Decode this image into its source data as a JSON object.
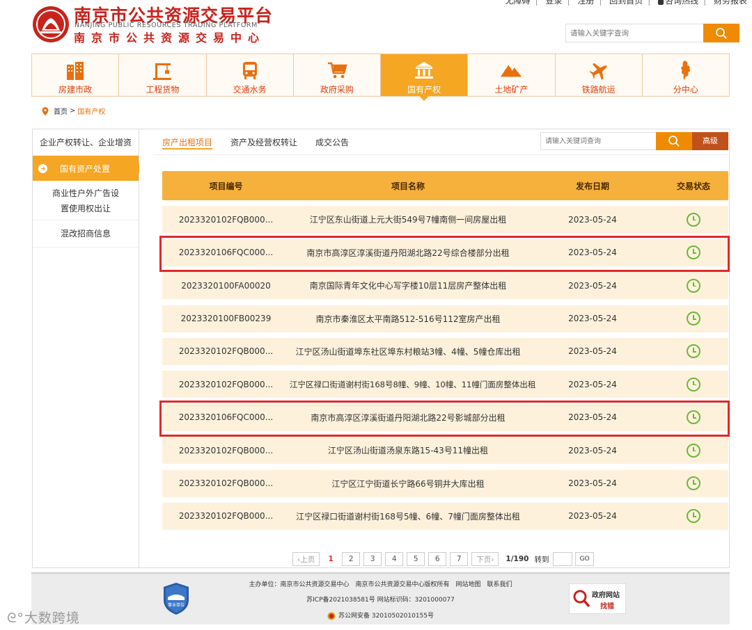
{
  "header": {
    "title": "南京市公共资源交易平台",
    "title_en": "NANJING PUBLIC RESOURCES TRADING PLATFORM",
    "subtitle": "南京市公共资源交易中心",
    "top_links": [
      "无障碍",
      "登录",
      "注册",
      "回到首页",
      "咨询热线",
      "财务报表"
    ],
    "search_placeholder": "请输入关键字查询"
  },
  "nav": {
    "items": [
      {
        "label": "房建市政",
        "icon": "building-icon"
      },
      {
        "label": "工程货物",
        "icon": "crane-icon"
      },
      {
        "label": "交通水务",
        "icon": "bus-icon"
      },
      {
        "label": "政府采购",
        "icon": "cart-icon"
      },
      {
        "label": "国有产权",
        "icon": "bank-icon",
        "active": true
      },
      {
        "label": "土地矿产",
        "icon": "mountain-icon"
      },
      {
        "label": "铁路航运",
        "icon": "plane-icon"
      },
      {
        "label": "分中心",
        "icon": "branch-icon"
      }
    ],
    "active_color": "#f5a623",
    "label_color": "#d9400e"
  },
  "breadcrumb": {
    "home": "首页",
    "sep": ">",
    "current": "国有产权"
  },
  "sidebar": {
    "header": "企业产权转让、企业增资",
    "active": "国有资产处置",
    "items": [
      "商业性户外广告设置使用权出让",
      "混改招商信息"
    ]
  },
  "main": {
    "tabs": [
      "房产出租项目",
      "资产及经营权转让",
      "成交公告"
    ],
    "search_placeholder": "请输入关键词查询",
    "advanced_label": "高级"
  },
  "table": {
    "columns": [
      "项目编号",
      "项目名称",
      "发布日期",
      "交易状态"
    ],
    "rows": [
      {
        "id": "2023320102FQB000...",
        "name": "江宁区东山街道上元大街549号7幢南侧一间房屋出租",
        "date": "2023-05-24",
        "highlighted": false
      },
      {
        "id": "2023320106FQC000...",
        "name": "南京市高淳区淳溪街道丹阳湖北路22号综合楼部分出租",
        "date": "2023-05-24",
        "highlighted": true
      },
      {
        "id": "2023320100FA00020",
        "name": "南京国际青年文化中心写字楼10层11层房产整体出租",
        "date": "2023-05-24",
        "highlighted": false
      },
      {
        "id": "2023320100FB00239",
        "name": "南京市秦淮区太平南路512-516号112室房产出租",
        "date": "2023-05-24",
        "highlighted": false
      },
      {
        "id": "2023320102FQB000...",
        "name": "江宁区汤山街道埠东社区埠东村粮站3幢、4幢、5幢仓库出租",
        "date": "2023-05-24",
        "highlighted": false
      },
      {
        "id": "2023320102FQB000...",
        "name": "江宁区禄口街道谢村街168号8幢、9幢、10幢、11幢门面房整体出租",
        "date": "2023-05-24",
        "highlighted": false
      },
      {
        "id": "2023320106FQC000...",
        "name": "南京市高淳区淳溪街道丹阳湖北路22号影城部分出租",
        "date": "2023-05-24",
        "highlighted": true
      },
      {
        "id": "2023320102FQB000...",
        "name": "江宁区汤山街道汤泉东路15-43号11幢出租",
        "date": "2023-05-24",
        "highlighted": false
      },
      {
        "id": "2023320102FQB000...",
        "name": "江宁区江宁街道长宁路66号铜井大库出租",
        "date": "2023-05-24",
        "highlighted": false
      },
      {
        "id": "2023320102FQB000...",
        "name": "江宁区禄口街道谢村街168号5幢、6幢、7幢门面房整体出租",
        "date": "2023-05-24",
        "highlighted": false
      }
    ],
    "status_icon": "clock-icon",
    "status_color": "#6cb83a",
    "highlight_color": "#e0282a"
  },
  "pager": {
    "prev": "‹上页",
    "pages": [
      "1",
      "2",
      "3",
      "4",
      "5",
      "6",
      "7"
    ],
    "current": "1",
    "next": "下页›",
    "total": "1/190",
    "goto_label": "转到",
    "go": "GO"
  },
  "footer": {
    "line1": "主办单位：南京市公共资源交易中心　南京市公共资源交易中心版权所有　网站地图　联系我们",
    "line2": "苏ICP备2021038581号  网站标识码：3201000077",
    "line3": "苏公网安备 32010502010155号",
    "badge_text": "事业单位",
    "gov_text": "政府网站",
    "gov_sub": "找错"
  },
  "watermark": "大数跨境"
}
